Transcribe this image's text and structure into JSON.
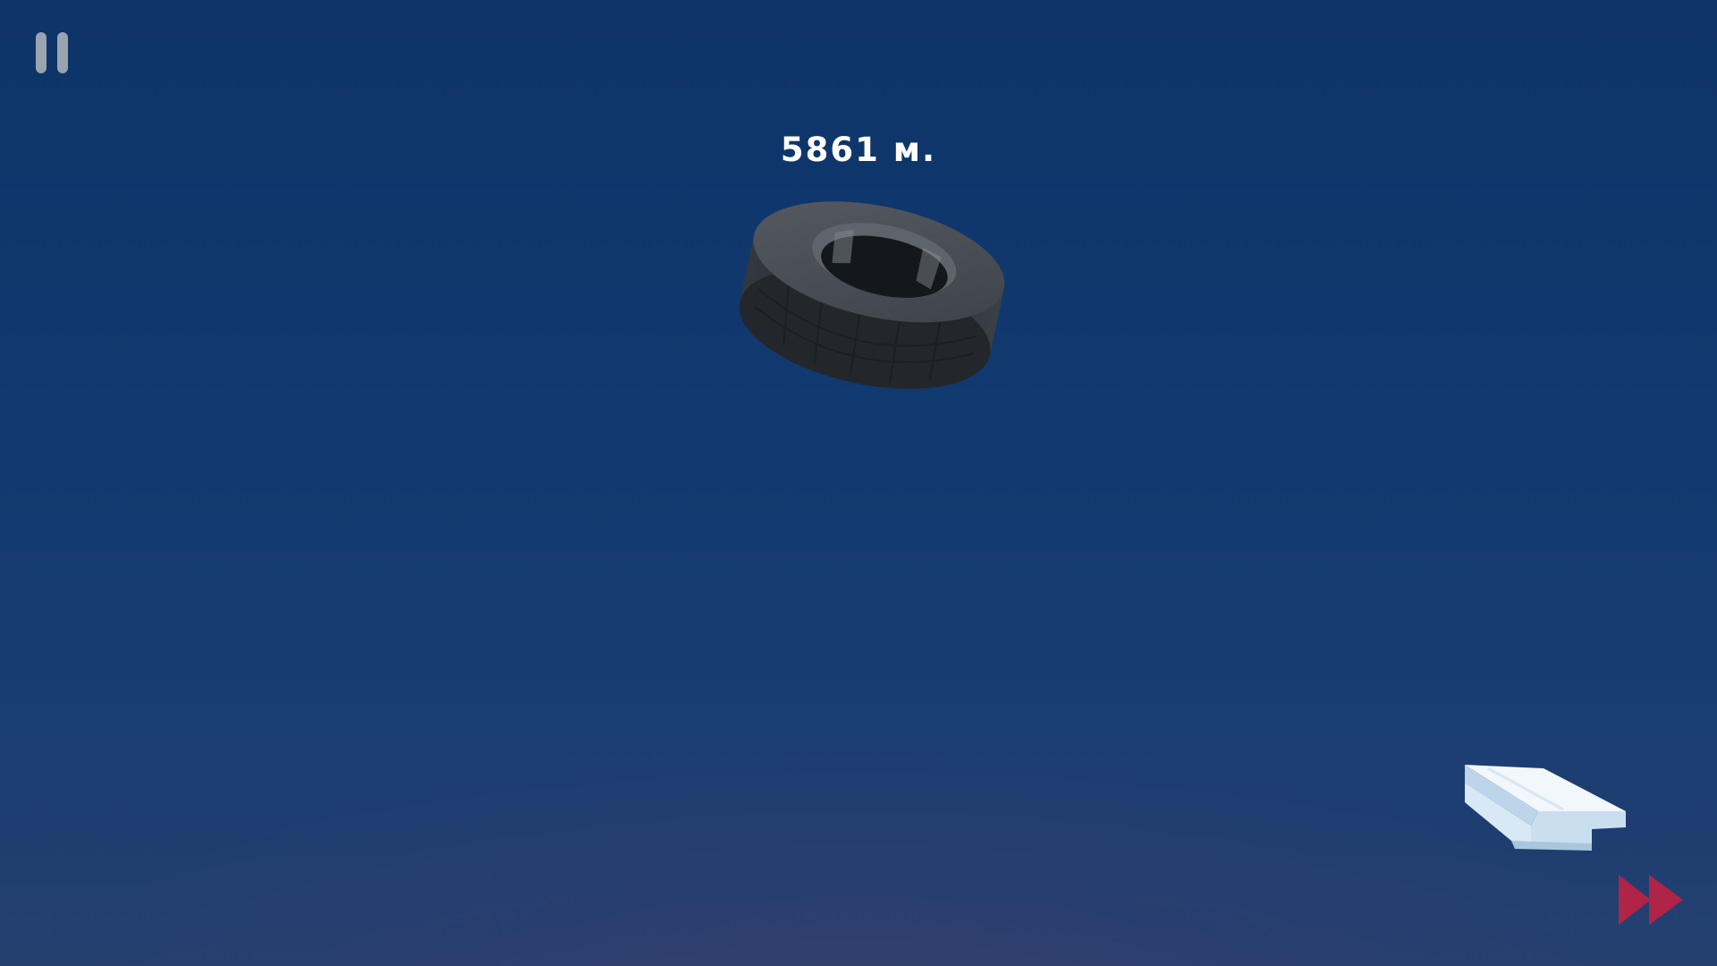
{
  "hud": {
    "distance_text": "5861 м.",
    "pause_icon": "pause-icon",
    "fast_forward_icon": "fast-forward-icon"
  },
  "scene": {
    "objects": [
      "tire",
      "ice-block"
    ]
  },
  "colors": {
    "sky_top": "#0e3468",
    "sky_bottom": "#24406f",
    "accent_fast_forward": "#b02447",
    "text": "#ffffff",
    "pause": "#9aa3b0"
  }
}
